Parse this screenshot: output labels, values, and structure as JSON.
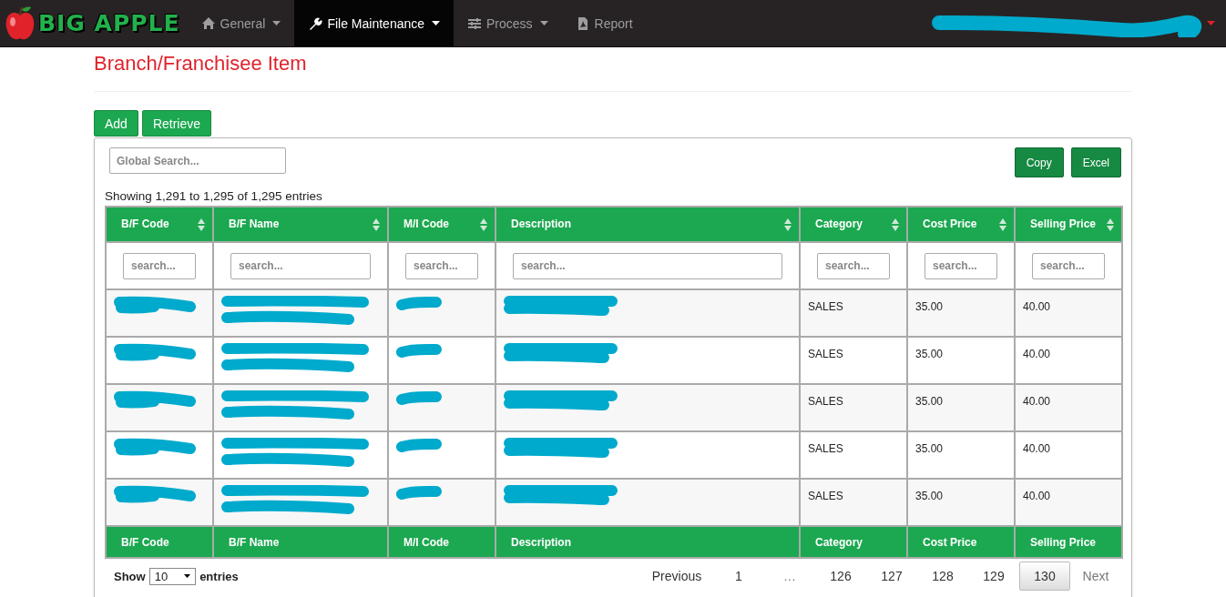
{
  "navbar": {
    "logo": "BIG APPLE",
    "menu": [
      {
        "label": "General",
        "dropdown": true,
        "selected": false
      },
      {
        "label": "File Maintenance",
        "dropdown": true,
        "selected": true
      },
      {
        "label": "Process",
        "dropdown": true,
        "selected": false
      },
      {
        "label": "Report",
        "dropdown": false,
        "selected": false
      }
    ],
    "user_menu": {
      "redacted": true
    }
  },
  "page_title": "Branch/Franchisee Item",
  "actions": [
    "Add",
    "Retrieve"
  ],
  "global_search": {
    "placeholder": "Global Search..."
  },
  "export_buttons": [
    "Copy",
    "Excel"
  ],
  "info": "Showing 1,291 to 1,295 of 1,295 entries",
  "table": {
    "columns": [
      {
        "label": "B/F Code",
        "redacted": true,
        "placeholder": "search..."
      },
      {
        "label": "B/F Name",
        "redacted": true,
        "placeholder": "search..."
      },
      {
        "label": "M/I Code",
        "redacted": true,
        "placeholder": "search..."
      },
      {
        "label": "Description",
        "redacted": true,
        "placeholder": "search..."
      },
      {
        "label": "Category",
        "redacted": false,
        "placeholder": "search..."
      },
      {
        "label": "Cost Price",
        "redacted": false,
        "placeholder": "search..."
      },
      {
        "label": "Selling Price",
        "redacted": false,
        "placeholder": "search..."
      }
    ],
    "rows": [
      {
        "cells": [
          "SALES",
          "35.00",
          "40.00"
        ]
      },
      {
        "cells": [
          "SALES",
          "35.00",
          "40.00"
        ]
      },
      {
        "cells": [
          "SALES",
          "35.00",
          "40.00"
        ]
      },
      {
        "cells": [
          "SALES",
          "35.00",
          "40.00"
        ]
      },
      {
        "cells": [
          "SALES",
          "35.00",
          "40.00"
        ]
      }
    ],
    "footer": [
      "B/F Code",
      "B/F Name",
      "M/I Code",
      "Description",
      "Category",
      "Cost Price",
      "Selling Price"
    ]
  },
  "length_menu": {
    "before": "Show",
    "value": "10",
    "after": "entries"
  },
  "pagination": [
    {
      "label": "Previous",
      "selected": false,
      "disabled": false
    },
    {
      "label": "1",
      "selected": false,
      "disabled": false
    },
    {
      "label": "…",
      "selected": false,
      "disabled": true
    },
    {
      "label": "126",
      "selected": false,
      "disabled": false
    },
    {
      "label": "127",
      "selected": false,
      "disabled": false
    },
    {
      "label": "128",
      "selected": false,
      "disabled": false
    },
    {
      "label": "129",
      "selected": false,
      "disabled": false
    },
    {
      "label": "130",
      "selected": true,
      "disabled": false
    },
    {
      "label": "Next",
      "selected": false,
      "disabled": true
    }
  ]
}
